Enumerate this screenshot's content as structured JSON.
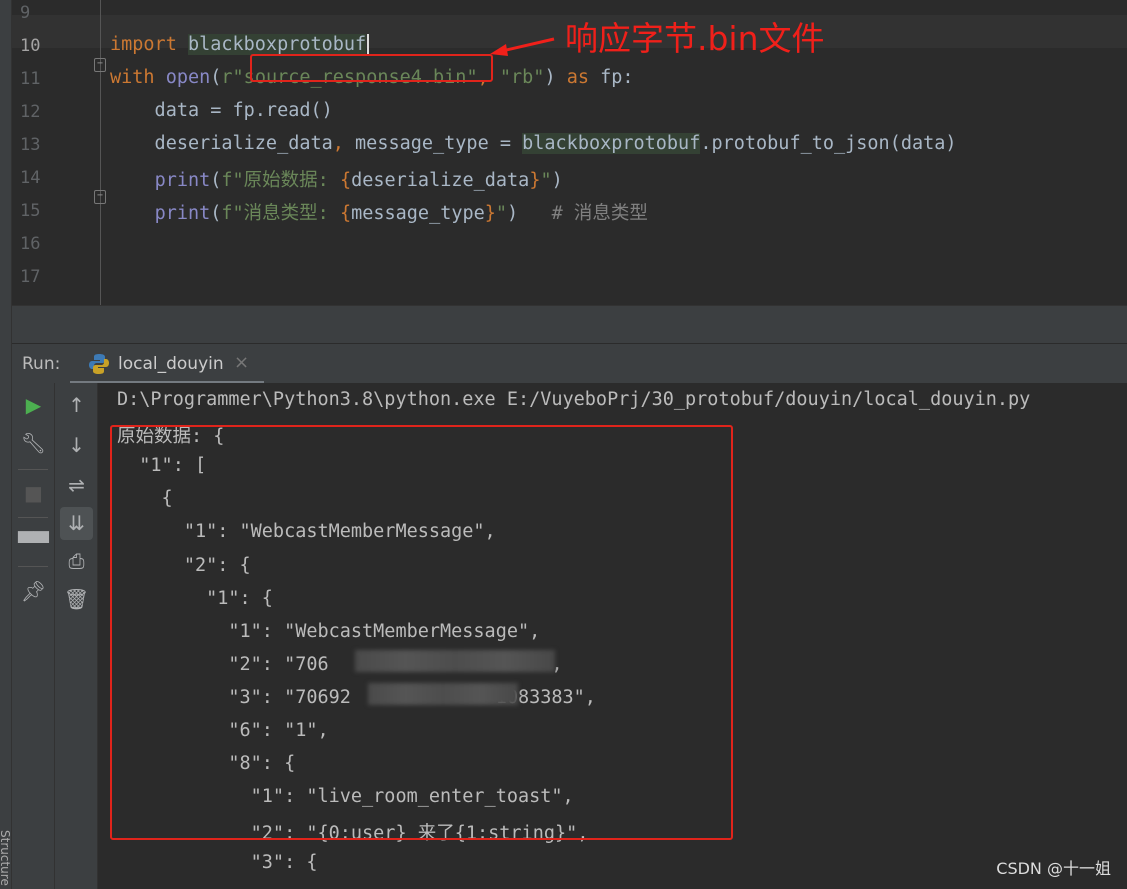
{
  "editor": {
    "lines": [
      {
        "num": "9",
        "tokens": []
      },
      {
        "num": "10",
        "tokens": [
          {
            "t": "import ",
            "c": "kw"
          },
          {
            "t": "blackboxprotobuf",
            "c": "hl"
          }
        ]
      },
      {
        "num": "11",
        "tokens": [
          {
            "t": "with ",
            "c": "kw"
          },
          {
            "t": "open",
            "c": "bi"
          },
          {
            "t": "(",
            "c": ""
          },
          {
            "t": "r\"source_response4.bin\"",
            "c": "str"
          },
          {
            "t": ", ",
            "c": "kw"
          },
          {
            "t": "\"rb\"",
            "c": "str"
          },
          {
            "t": ") ",
            "c": ""
          },
          {
            "t": "as ",
            "c": "kw"
          },
          {
            "t": "fp:",
            "c": ""
          }
        ]
      },
      {
        "num": "12",
        "tokens": [
          {
            "t": "    data = fp.read()",
            "c": ""
          }
        ]
      },
      {
        "num": "13",
        "tokens": [
          {
            "t": "    deserialize_data",
            "c": ""
          },
          {
            "t": ", ",
            "c": "kw"
          },
          {
            "t": "message_type = ",
            "c": ""
          },
          {
            "t": "blackboxprotobuf",
            "c": "hl"
          },
          {
            "t": ".protobuf_to_json(data)",
            "c": ""
          }
        ]
      },
      {
        "num": "14",
        "tokens": [
          {
            "t": "    ",
            "c": ""
          },
          {
            "t": "print",
            "c": "bi"
          },
          {
            "t": "(",
            "c": ""
          },
          {
            "t": "f\"原始数据: ",
            "c": "str"
          },
          {
            "t": "{",
            "c": "br"
          },
          {
            "t": "deserialize_data",
            "c": ""
          },
          {
            "t": "}",
            "c": "br"
          },
          {
            "t": "\"",
            "c": "str"
          },
          {
            "t": ")",
            "c": ""
          }
        ]
      },
      {
        "num": "15",
        "tokens": [
          {
            "t": "    ",
            "c": ""
          },
          {
            "t": "print",
            "c": "bi"
          },
          {
            "t": "(",
            "c": ""
          },
          {
            "t": "f\"消息类型: ",
            "c": "str"
          },
          {
            "t": "{",
            "c": "br"
          },
          {
            "t": "message_type",
            "c": ""
          },
          {
            "t": "}",
            "c": "br"
          },
          {
            "t": "\"",
            "c": "str"
          },
          {
            "t": ")   ",
            "c": ""
          },
          {
            "t": "# 消息类型",
            "c": "cm"
          }
        ]
      },
      {
        "num": "16",
        "tokens": []
      },
      {
        "num": "17",
        "tokens": []
      }
    ]
  },
  "annotation": {
    "text": "响应字节.bin文件",
    "color": "#f0201a"
  },
  "run": {
    "label": "Run:",
    "tab": "local_douyin",
    "close": "×"
  },
  "toolbar_left": [
    "run-icon",
    "wrench-icon",
    "stop-icon",
    "layout-icon",
    "pin-icon"
  ],
  "toolbar_right": [
    "arrow-up-icon",
    "arrow-down-icon",
    "soft-wrap-icon",
    "scroll-to-end-icon",
    "print-icon",
    "trash-icon"
  ],
  "console": {
    "lines": [
      "D:\\Programmer\\Python3.8\\python.exe E:/VuyeboPrj/30_protobuf/douyin/local_douyin.py",
      "原始数据: {",
      "  \"1\": [",
      "    {",
      "      \"1\": \"WebcastMemberMessage\",",
      "      \"2\": {",
      "        \"1\": {",
      "          \"1\": \"WebcastMemberMessage\",",
      "          \"2\": \"706                   \",",
      "          \"3\": \"70692             1083383\",",
      "          \"6\": \"1\",",
      "          \"8\": {",
      "            \"1\": \"live_room_enter_toast\",",
      "            \"2\": \"{0:user} 来了{1:string}\",",
      "            \"3\": {"
    ]
  },
  "watermark": "CSDN @十一姐",
  "side_label": "Structure"
}
